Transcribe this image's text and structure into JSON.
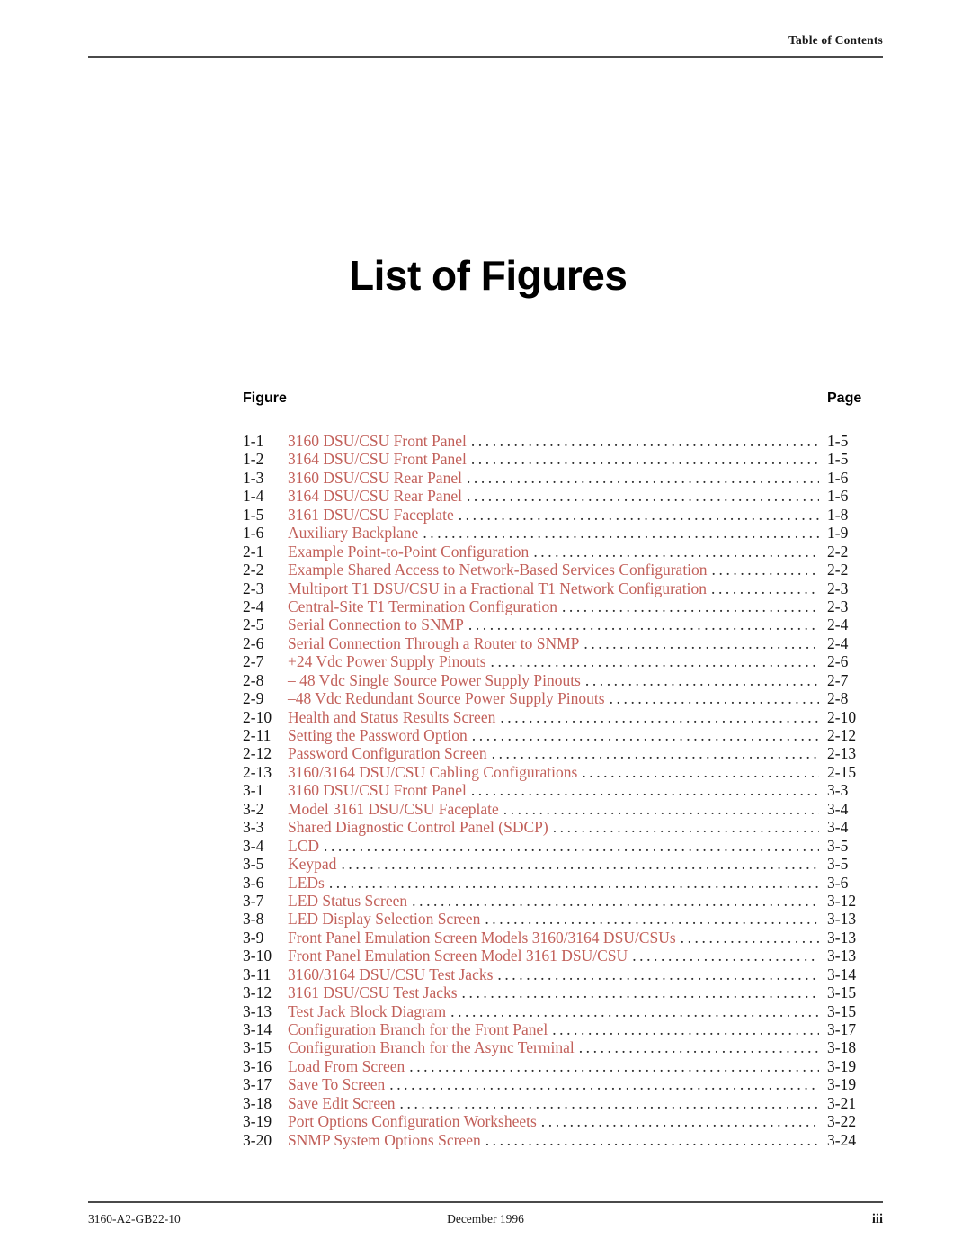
{
  "header": {
    "running_head": "Table of Contents"
  },
  "title": "List of Figures",
  "columns": {
    "figure_label": "Figure",
    "page_label": "Page"
  },
  "colors": {
    "entry_title": "#c2605a",
    "entry_number": "#141414",
    "leader_dots": "#2b2b2b",
    "rule": "#4a4a4a"
  },
  "entries": [
    {
      "number": "1-1",
      "title": "3160 DSU/CSU Front Panel",
      "page": "1-5"
    },
    {
      "number": "1-2",
      "title": "3164 DSU/CSU Front Panel",
      "page": "1-5"
    },
    {
      "number": "1-3",
      "title": "3160 DSU/CSU Rear Panel",
      "page": "1-6"
    },
    {
      "number": "1-4",
      "title": "3164 DSU/CSU Rear Panel",
      "page": "1-6"
    },
    {
      "number": "1-5",
      "title": "3161 DSU/CSU Faceplate",
      "page": "1-8"
    },
    {
      "number": "1-6",
      "title": "Auxiliary Backplane",
      "page": "1-9"
    },
    {
      "number": "2-1",
      "title": "Example Point-to-Point Configuration",
      "page": "2-2"
    },
    {
      "number": "2-2",
      "title": "Example Shared Access to Network-Based Services Configuration",
      "page": "2-2"
    },
    {
      "number": "2-3",
      "title": "Multiport T1 DSU/CSU in a Fractional T1 Network Configuration",
      "page": "2-3"
    },
    {
      "number": "2-4",
      "title": "Central-Site T1 Termination Configuration",
      "page": "2-3"
    },
    {
      "number": "2-5",
      "title": "Serial Connection to SNMP",
      "page": "2-4"
    },
    {
      "number": "2-6",
      "title": "Serial Connection Through a Router to SNMP",
      "page": "2-4"
    },
    {
      "number": "2-7",
      "title": "+24 Vdc Power Supply Pinouts",
      "page": "2-6"
    },
    {
      "number": "2-8",
      "title": "– 48 Vdc Single Source Power Supply Pinouts",
      "page": "2-7"
    },
    {
      "number": "2-9",
      "title": "–48 Vdc Redundant Source Power Supply Pinouts",
      "page": "2-8"
    },
    {
      "number": "2-10",
      "title": "Health and Status Results Screen",
      "page": "2-10"
    },
    {
      "number": "2-11",
      "title": "Setting the Password Option",
      "page": "2-12"
    },
    {
      "number": "2-12",
      "title": "Password Configuration Screen",
      "page": "2-13"
    },
    {
      "number": "2-13",
      "title": "3160/3164 DSU/CSU Cabling Configurations",
      "page": "2-15"
    },
    {
      "number": "3-1",
      "title": "3160 DSU/CSU Front Panel",
      "page": "3-3"
    },
    {
      "number": "3-2",
      "title": "Model 3161 DSU/CSU Faceplate",
      "page": "3-4"
    },
    {
      "number": "3-3",
      "title": "Shared Diagnostic Control Panel (SDCP)",
      "page": "3-4"
    },
    {
      "number": "3-4",
      "title": "LCD",
      "page": "3-5"
    },
    {
      "number": "3-5",
      "title": "Keypad",
      "page": "3-5"
    },
    {
      "number": "3-6",
      "title": "LEDs",
      "page": "3-6"
    },
    {
      "number": "3-7",
      "title": "LED Status Screen",
      "page": "3-12"
    },
    {
      "number": "3-8",
      "title": "LED Display Selection Screen",
      "page": "3-13"
    },
    {
      "number": "3-9",
      "title": "Front Panel Emulation Screen Models 3160/3164 DSU/CSUs",
      "page": "3-13"
    },
    {
      "number": "3-10",
      "title": "Front Panel Emulation Screen Model 3161 DSU/CSU",
      "page": "3-13"
    },
    {
      "number": "3-11",
      "title": "3160/3164 DSU/CSU Test Jacks",
      "page": "3-14"
    },
    {
      "number": "3-12",
      "title": "3161 DSU/CSU Test Jacks",
      "page": "3-15"
    },
    {
      "number": "3-13",
      "title": "Test Jack Block Diagram",
      "page": "3-15"
    },
    {
      "number": "3-14",
      "title": "Configuration Branch for the Front Panel",
      "page": "3-17"
    },
    {
      "number": "3-15",
      "title": "Configuration Branch for the Async Terminal",
      "page": "3-18"
    },
    {
      "number": "3-16",
      "title": "Load From Screen",
      "page": "3-19"
    },
    {
      "number": "3-17",
      "title": "Save To Screen",
      "page": "3-19"
    },
    {
      "number": "3-18",
      "title": "Save Edit Screen",
      "page": "3-21"
    },
    {
      "number": "3-19",
      "title": "Port Options Configuration Worksheets",
      "page": "3-22"
    },
    {
      "number": "3-20",
      "title": "SNMP System Options Screen",
      "page": "3-24"
    }
  ],
  "footer": {
    "document_number": "3160-A2-GB22-10",
    "date": "December 1996",
    "folio": "iii"
  }
}
